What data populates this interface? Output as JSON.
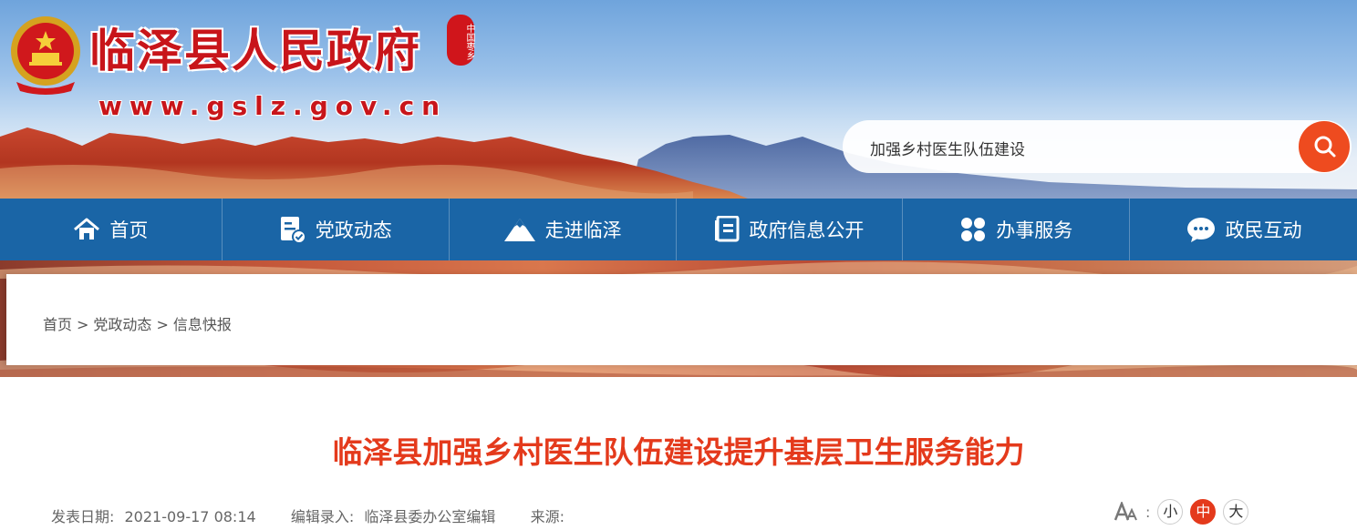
{
  "header": {
    "site_name": "临泽县人民政府",
    "seal_text": "中国枣乡",
    "site_url": "www.gslz.gov.cn"
  },
  "search": {
    "value": "加强乡村医生队伍建设",
    "button_icon": "search-icon"
  },
  "nav": {
    "items": [
      {
        "label": "首页",
        "icon": "home-icon"
      },
      {
        "label": "党政动态",
        "icon": "document-check-icon"
      },
      {
        "label": "走进临泽",
        "icon": "mountain-icon"
      },
      {
        "label": "政府信息公开",
        "icon": "file-list-icon"
      },
      {
        "label": "办事服务",
        "icon": "grid-icon"
      },
      {
        "label": "政民互动",
        "icon": "chat-icon"
      }
    ]
  },
  "breadcrumb": {
    "items": [
      "首页",
      "党政动态",
      "信息快报"
    ],
    "separator": ">"
  },
  "article": {
    "title": "临泽县加强乡村医生队伍建设提升基层卫生服务能力",
    "publish_label": "发表日期:",
    "publish_date": "2021-09-17 08:14",
    "editor_label": "编辑录入:",
    "editor": "临泽县委办公室编辑",
    "source_label": "来源:",
    "source": ""
  },
  "font_size": {
    "label": ":",
    "options": [
      "小",
      "中",
      "大"
    ],
    "selected": "中"
  },
  "colors": {
    "nav_bg": "#1a65a6",
    "title_red": "#e43a1c",
    "search_button": "#ee4b1f",
    "site_name_red": "#c8151a"
  }
}
